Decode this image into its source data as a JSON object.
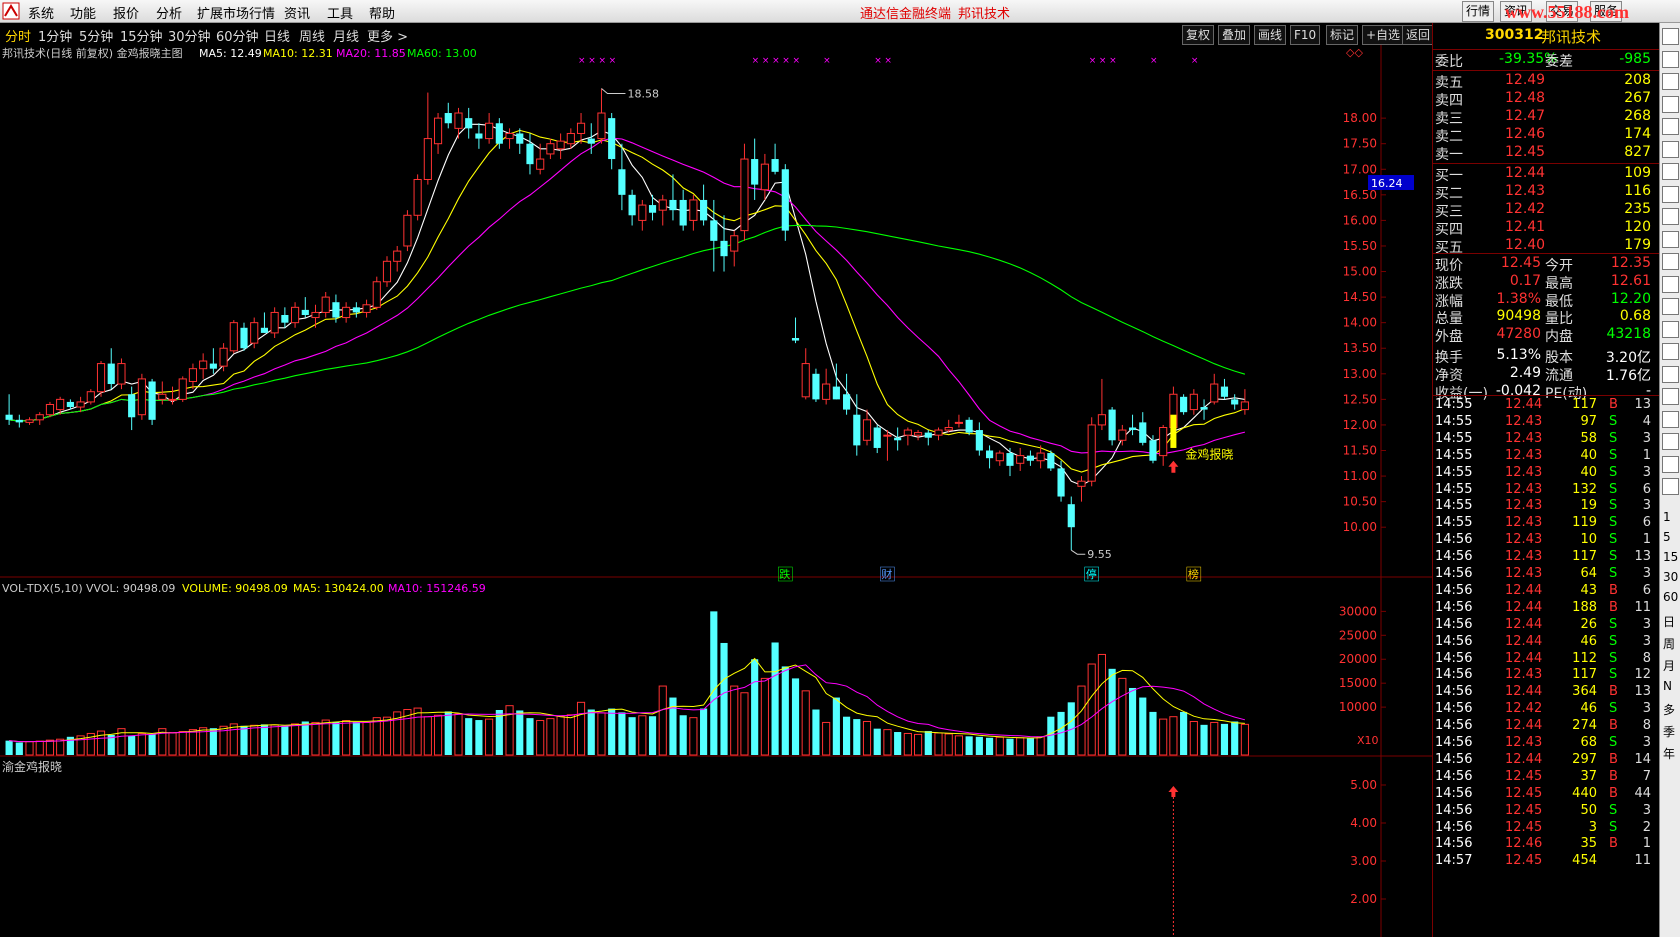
{
  "menu": {
    "items": [
      "系统",
      "功能",
      "报价",
      "分析",
      "扩展市场行情",
      "资讯",
      "工具",
      "帮助"
    ],
    "center_text_1": "通达信金融终端",
    "center_text_2": "邦讯技术",
    "right_buttons": [
      "行情",
      "资讯",
      "交易",
      "服务"
    ],
    "watermark": "www.55188.com"
  },
  "tabs": {
    "items": [
      "分时",
      "1分钟",
      "5分钟",
      "15分钟",
      "30分钟",
      "60分钟",
      "日线",
      "周线",
      "月线",
      "更多 >"
    ],
    "active": "分时",
    "right_buttons": [
      "复权",
      "叠加",
      "画线",
      "F10",
      "标记",
      "+自选",
      "返回"
    ]
  },
  "main_chart": {
    "title": "邦讯技术(日线 前复权) 金鸡报晓主图",
    "ma5": "MA5: 12.49",
    "ma10": "MA10: 12.31",
    "ma20": "MA20: 11.85",
    "ma60": "MA60: 13.00",
    "y_ticks": [
      "18.00",
      "17.50",
      "17.00",
      "16.50",
      "16.00",
      "15.50",
      "15.00",
      "14.50",
      "14.00",
      "13.50",
      "13.00",
      "12.50",
      "12.00",
      "11.50",
      "11.00",
      "10.50",
      "10.00"
    ],
    "current_price_label": "16.24",
    "high_label": "18.58",
    "low_label": "9.55",
    "signal_label": "金鸡报晓",
    "event_labels": [
      "跌",
      "财",
      "停",
      "榜"
    ],
    "colors": {
      "up": "#ff3232",
      "down": "#54ffff",
      "ma5": "#ffffff",
      "ma10": "#ffff00",
      "ma20": "#ff00ff",
      "ma60": "#00ff00",
      "signal": "#ffff00"
    }
  },
  "chart_data": {
    "type": "candlestick",
    "ylim": [
      9.3,
      19.0
    ],
    "candles": [
      [
        12.2,
        12.6,
        12.0,
        12.1
      ],
      [
        12.1,
        12.2,
        11.95,
        12.05
      ],
      [
        12.05,
        12.15,
        12.0,
        12.1
      ],
      [
        12.1,
        12.25,
        12.0,
        12.2
      ],
      [
        12.2,
        12.45,
        12.15,
        12.4
      ],
      [
        12.3,
        12.55,
        12.2,
        12.5
      ],
      [
        12.45,
        12.5,
        12.3,
        12.35
      ],
      [
        12.35,
        12.55,
        12.25,
        12.45
      ],
      [
        12.45,
        12.7,
        12.4,
        12.65
      ],
      [
        12.65,
        13.25,
        12.55,
        13.2
      ],
      [
        13.2,
        13.5,
        12.7,
        12.8
      ],
      [
        12.8,
        13.3,
        12.7,
        13.2
      ],
      [
        12.6,
        12.75,
        11.9,
        12.15
      ],
      [
        12.2,
        13.0,
        12.1,
        12.9
      ],
      [
        12.85,
        12.9,
        12.0,
        12.1
      ],
      [
        12.5,
        12.85,
        12.4,
        12.6
      ],
      [
        12.5,
        12.75,
        12.4,
        12.5
      ],
      [
        12.5,
        12.95,
        12.45,
        12.9
      ],
      [
        12.85,
        13.2,
        12.7,
        13.1
      ],
      [
        13.1,
        13.4,
        12.9,
        13.25
      ],
      [
        13.2,
        13.5,
        13.0,
        13.1
      ],
      [
        13.15,
        13.6,
        13.05,
        13.5
      ],
      [
        13.45,
        14.05,
        13.4,
        14.0
      ],
      [
        13.9,
        14.0,
        13.45,
        13.5
      ],
      [
        13.6,
        14.1,
        13.5,
        14.0
      ],
      [
        13.9,
        14.2,
        13.8,
        13.8
      ],
      [
        13.8,
        14.3,
        13.7,
        14.2
      ],
      [
        14.15,
        14.3,
        13.9,
        14.0
      ],
      [
        14.0,
        14.4,
        13.9,
        14.3
      ],
      [
        14.25,
        14.5,
        14.1,
        14.15
      ],
      [
        14.1,
        14.35,
        13.9,
        14.2
      ],
      [
        14.2,
        14.6,
        14.1,
        14.5
      ],
      [
        14.4,
        14.55,
        14.0,
        14.1
      ],
      [
        14.1,
        14.4,
        14.0,
        14.3
      ],
      [
        14.3,
        14.4,
        14.1,
        14.2
      ],
      [
        14.2,
        14.45,
        14.1,
        14.35
      ],
      [
        14.3,
        14.9,
        14.25,
        14.8
      ],
      [
        14.8,
        15.3,
        14.7,
        15.2
      ],
      [
        15.2,
        15.5,
        15.0,
        15.4
      ],
      [
        15.5,
        16.2,
        15.4,
        16.1
      ],
      [
        16.1,
        16.9,
        16.0,
        16.8
      ],
      [
        16.8,
        18.5,
        16.7,
        17.6
      ],
      [
        17.5,
        18.1,
        17.3,
        18.0
      ],
      [
        18.1,
        18.3,
        17.8,
        17.9
      ],
      [
        17.8,
        18.2,
        17.6,
        18.1
      ],
      [
        18.0,
        18.2,
        17.6,
        17.8
      ],
      [
        17.7,
        17.9,
        17.4,
        17.6
      ],
      [
        17.6,
        18.1,
        17.5,
        17.9
      ],
      [
        17.9,
        18.0,
        17.4,
        17.5
      ],
      [
        17.6,
        17.8,
        17.4,
        17.7
      ],
      [
        17.7,
        17.8,
        17.3,
        17.5
      ],
      [
        17.5,
        17.7,
        16.9,
        17.1
      ],
      [
        17.0,
        17.5,
        16.9,
        17.2
      ],
      [
        17.3,
        17.6,
        17.2,
        17.5
      ],
      [
        17.4,
        17.7,
        17.2,
        17.55
      ],
      [
        17.5,
        17.8,
        17.4,
        17.7
      ],
      [
        17.7,
        18.1,
        17.5,
        17.9
      ],
      [
        17.6,
        17.9,
        17.3,
        17.5
      ],
      [
        17.6,
        18.58,
        17.5,
        18.1
      ],
      [
        18.0,
        18.1,
        17.0,
        17.2
      ],
      [
        17.0,
        17.5,
        16.2,
        16.5
      ],
      [
        16.5,
        16.6,
        15.9,
        16.1
      ],
      [
        16.0,
        16.4,
        15.8,
        16.3
      ],
      [
        16.3,
        16.5,
        16.0,
        16.15
      ],
      [
        16.2,
        16.5,
        15.9,
        16.4
      ],
      [
        16.4,
        16.9,
        16.0,
        16.2
      ],
      [
        16.4,
        16.6,
        15.8,
        15.9
      ],
      [
        16.0,
        16.5,
        15.8,
        16.4
      ],
      [
        16.4,
        16.7,
        15.9,
        16.0
      ],
      [
        16.0,
        16.4,
        15.0,
        15.6
      ],
      [
        15.6,
        16.1,
        15.0,
        15.3
      ],
      [
        15.4,
        15.8,
        15.1,
        15.7
      ],
      [
        15.8,
        17.5,
        15.6,
        17.2
      ],
      [
        17.2,
        17.6,
        16.4,
        16.7
      ],
      [
        16.6,
        17.3,
        16.4,
        17.1
      ],
      [
        17.2,
        17.5,
        16.9,
        16.95
      ],
      [
        17.0,
        17.1,
        15.6,
        15.8
      ],
      [
        13.7,
        14.1,
        13.6,
        13.65
      ],
      [
        12.55,
        13.5,
        12.5,
        13.2
      ],
      [
        13.0,
        13.1,
        12.45,
        12.5
      ],
      [
        12.5,
        13.1,
        12.4,
        12.8
      ],
      [
        12.75,
        13.2,
        12.5,
        12.5
      ],
      [
        12.6,
        13.0,
        12.2,
        12.3
      ],
      [
        12.2,
        12.6,
        11.4,
        11.6
      ],
      [
        11.7,
        12.3,
        11.6,
        12.1
      ],
      [
        11.95,
        12.0,
        11.45,
        11.55
      ],
      [
        11.8,
        11.9,
        11.3,
        11.8
      ],
      [
        11.75,
        11.95,
        11.5,
        11.7
      ],
      [
        11.8,
        11.95,
        11.6,
        11.9
      ],
      [
        11.8,
        11.9,
        11.7,
        11.85
      ],
      [
        11.85,
        11.9,
        11.6,
        11.75
      ],
      [
        11.8,
        11.95,
        11.7,
        11.9
      ],
      [
        11.9,
        12.1,
        11.85,
        11.95
      ],
      [
        12.05,
        12.2,
        11.95,
        12.05
      ],
      [
        12.1,
        12.15,
        11.8,
        11.85
      ],
      [
        11.9,
        12.05,
        11.4,
        11.5
      ],
      [
        11.5,
        11.6,
        11.15,
        11.35
      ],
      [
        11.3,
        11.5,
        11.2,
        11.45
      ],
      [
        11.45,
        11.55,
        11.0,
        11.2
      ],
      [
        11.25,
        11.55,
        11.1,
        11.4
      ],
      [
        11.4,
        11.5,
        11.2,
        11.3
      ],
      [
        11.3,
        11.6,
        11.15,
        11.45
      ],
      [
        11.45,
        11.5,
        11.1,
        11.15
      ],
      [
        11.15,
        11.3,
        10.5,
        10.6
      ],
      [
        10.45,
        10.6,
        9.55,
        10.0
      ],
      [
        10.8,
        11.0,
        10.5,
        10.9
      ],
      [
        10.9,
        12.15,
        10.8,
        12.0
      ],
      [
        12.0,
        12.9,
        11.9,
        12.2
      ],
      [
        12.3,
        12.35,
        11.6,
        11.7
      ],
      [
        11.7,
        12.0,
        11.6,
        11.9
      ],
      [
        11.95,
        12.2,
        11.8,
        11.9
      ],
      [
        12.05,
        12.25,
        11.6,
        11.65
      ],
      [
        11.7,
        11.8,
        11.25,
        11.3
      ],
      [
        11.4,
        12.0,
        11.2,
        11.95
      ],
      [
        11.95,
        12.75,
        11.8,
        12.6
      ],
      [
        12.55,
        12.6,
        12.2,
        12.25
      ],
      [
        12.3,
        12.7,
        12.2,
        12.6
      ],
      [
        12.35,
        12.5,
        12.1,
        12.3
      ],
      [
        12.45,
        13.0,
        12.4,
        12.8
      ],
      [
        12.75,
        12.9,
        12.5,
        12.55
      ],
      [
        12.5,
        12.6,
        12.3,
        12.4
      ],
      [
        12.3,
        12.7,
        12.2,
        12.45
      ]
    ],
    "volumes": [
      3000,
      2600,
      2800,
      2900,
      3100,
      3300,
      3800,
      4000,
      4500,
      5000,
      4200,
      5500,
      4000,
      4500,
      4300,
      5500,
      4700,
      4900,
      5300,
      5700,
      5600,
      6000,
      6500,
      6100,
      6200,
      6400,
      6300,
      6100,
      6500,
      7000,
      6800,
      7300,
      6900,
      7200,
      6900,
      6800,
      7800,
      7900,
      9000,
      9500,
      9800,
      8000,
      8300,
      9100,
      8600,
      7700,
      7300,
      7500,
      9400,
      10300,
      9300,
      7700,
      7200,
      7600,
      8100,
      8400,
      11000,
      9500,
      8800,
      9700,
      8900,
      7900,
      8200,
      8100,
      14400,
      12000,
      8300,
      7800,
      9700,
      30000,
      23400,
      14400,
      13000,
      20000,
      16000,
      23500,
      18500,
      16000,
      13400,
      9500,
      6800,
      12000,
      8000,
      7500,
      7000,
      5500,
      5300,
      4800,
      4500,
      4300,
      5000,
      4600,
      4400,
      4000,
      3900,
      3800,
      3600,
      3700,
      3400,
      3600,
      3500,
      3800,
      8000,
      9000,
      11000,
      14400,
      19000,
      21000,
      18000,
      16000,
      14000,
      12000,
      9000,
      7500,
      8000,
      9000,
      7000,
      6300,
      6800,
      6500,
      7000,
      6400
    ],
    "volume_ylim": [
      0,
      33000
    ],
    "volume_yticks": [
      "30000",
      "25000",
      "20000",
      "15000",
      "10000"
    ]
  },
  "volume_panel": {
    "title": "VOL-TDX(5,10)",
    "vvol": "VVOL: 90498.09",
    "volume": "VOLUME: 90498.09",
    "ma5": "MA5: 130424.00",
    "ma10": "MA10: 151246.59",
    "x10": "X10"
  },
  "indicator_panel": {
    "title": "渝金鸡报晓",
    "y_ticks": [
      "5.00",
      "4.00",
      "3.00",
      "2.00"
    ]
  },
  "quote": {
    "code": "300312",
    "name": "邦讯技术",
    "weibi_label": "委比",
    "weibi_value": "-39.35%",
    "weicha_label": "委差",
    "weicha_value": "-985",
    "asks": [
      {
        "label": "卖五",
        "price": "12.49",
        "vol": "208"
      },
      {
        "label": "卖四",
        "price": "12.48",
        "vol": "267"
      },
      {
        "label": "卖三",
        "price": "12.47",
        "vol": "268"
      },
      {
        "label": "卖二",
        "price": "12.46",
        "vol": "174"
      },
      {
        "label": "卖一",
        "price": "12.45",
        "vol": "827"
      }
    ],
    "bids": [
      {
        "label": "买一",
        "price": "12.44",
        "vol": "109"
      },
      {
        "label": "买二",
        "price": "12.43",
        "vol": "116"
      },
      {
        "label": "买三",
        "price": "12.42",
        "vol": "235"
      },
      {
        "label": "买四",
        "price": "12.41",
        "vol": "120"
      },
      {
        "label": "买五",
        "price": "12.40",
        "vol": "179"
      }
    ],
    "stats": [
      {
        "l1": "现价",
        "v1": "12.45",
        "c1": "#ff3232",
        "l2": "今开",
        "v2": "12.35",
        "c2": "#ff3232"
      },
      {
        "l1": "涨跌",
        "v1": "0.17",
        "c1": "#ff3232",
        "l2": "最高",
        "v2": "12.61",
        "c2": "#ff3232"
      },
      {
        "l1": "涨幅",
        "v1": "1.38%",
        "c1": "#ff3232",
        "l2": "最低",
        "v2": "12.20",
        "c2": "#00ff00"
      },
      {
        "l1": "总量",
        "v1": "90498",
        "c1": "#ffff00",
        "l2": "量比",
        "v2": "0.68",
        "c2": "#ffff00"
      },
      {
        "l1": "外盘",
        "v1": "47280",
        "c1": "#ff3232",
        "l2": "内盘",
        "v2": "43218",
        "c2": "#00ff00"
      },
      {
        "l1": "换手",
        "v1": "5.13%",
        "c1": "#ffffff",
        "l2": "股本",
        "v2": "3.20亿",
        "c2": "#ffffff"
      },
      {
        "l1": "净资",
        "v1": "2.49",
        "c1": "#ffffff",
        "l2": "流通",
        "v2": "1.76亿",
        "c2": "#ffffff"
      },
      {
        "l1": "收益(一)",
        "v1": "-0.042",
        "c1": "#ffffff",
        "l2": "PE(动)",
        "v2": "-",
        "c2": "#ffffff"
      }
    ],
    "ticks": [
      {
        "t": "14:55",
        "p": "12.44",
        "v": "117",
        "s": "B",
        "n": "13"
      },
      {
        "t": "14:55",
        "p": "12.43",
        "v": "97",
        "s": "S",
        "n": "4"
      },
      {
        "t": "14:55",
        "p": "12.43",
        "v": "58",
        "s": "S",
        "n": "3"
      },
      {
        "t": "14:55",
        "p": "12.43",
        "v": "40",
        "s": "S",
        "n": "1"
      },
      {
        "t": "14:55",
        "p": "12.43",
        "v": "40",
        "s": "S",
        "n": "3"
      },
      {
        "t": "14:55",
        "p": "12.43",
        "v": "132",
        "s": "S",
        "n": "6"
      },
      {
        "t": "14:55",
        "p": "12.43",
        "v": "19",
        "s": "S",
        "n": "3"
      },
      {
        "t": "14:55",
        "p": "12.43",
        "v": "119",
        "s": "S",
        "n": "6"
      },
      {
        "t": "14:56",
        "p": "12.43",
        "v": "10",
        "s": "S",
        "n": "1"
      },
      {
        "t": "14:56",
        "p": "12.43",
        "v": "117",
        "s": "S",
        "n": "13"
      },
      {
        "t": "14:56",
        "p": "12.43",
        "v": "64",
        "s": "S",
        "n": "3"
      },
      {
        "t": "14:56",
        "p": "12.44",
        "v": "43",
        "s": "B",
        "n": "6"
      },
      {
        "t": "14:56",
        "p": "12.44",
        "v": "188",
        "s": "B",
        "n": "11"
      },
      {
        "t": "14:56",
        "p": "12.44",
        "v": "26",
        "s": "S",
        "n": "3"
      },
      {
        "t": "14:56",
        "p": "12.44",
        "v": "46",
        "s": "S",
        "n": "3"
      },
      {
        "t": "14:56",
        "p": "12.44",
        "v": "112",
        "s": "S",
        "n": "8"
      },
      {
        "t": "14:56",
        "p": "12.43",
        "v": "117",
        "s": "S",
        "n": "12"
      },
      {
        "t": "14:56",
        "p": "12.44",
        "v": "364",
        "s": "B",
        "n": "13"
      },
      {
        "t": "14:56",
        "p": "12.42",
        "v": "46",
        "s": "S",
        "n": "3"
      },
      {
        "t": "14:56",
        "p": "12.44",
        "v": "274",
        "s": "B",
        "n": "8"
      },
      {
        "t": "14:56",
        "p": "12.43",
        "v": "68",
        "s": "S",
        "n": "3"
      },
      {
        "t": "14:56",
        "p": "12.44",
        "v": "297",
        "s": "B",
        "n": "14"
      },
      {
        "t": "14:56",
        "p": "12.45",
        "v": "37",
        "s": "B",
        "n": "7"
      },
      {
        "t": "14:56",
        "p": "12.45",
        "v": "440",
        "s": "B",
        "n": "44"
      },
      {
        "t": "14:56",
        "p": "12.45",
        "v": "50",
        "s": "S",
        "n": "3"
      },
      {
        "t": "14:56",
        "p": "12.45",
        "v": "3",
        "s": "S",
        "n": "2"
      },
      {
        "t": "14:56",
        "p": "12.46",
        "v": "35",
        "s": "B",
        "n": "1"
      },
      {
        "t": "14:57",
        "p": "12.45",
        "v": "454",
        "s": "",
        "n": "11"
      }
    ]
  },
  "sidebar": {
    "text_items": [
      "日",
      "周",
      "月",
      "N",
      "多",
      "季",
      "年"
    ],
    "number_items": [
      "1",
      "5",
      "15",
      "30",
      "60"
    ]
  }
}
